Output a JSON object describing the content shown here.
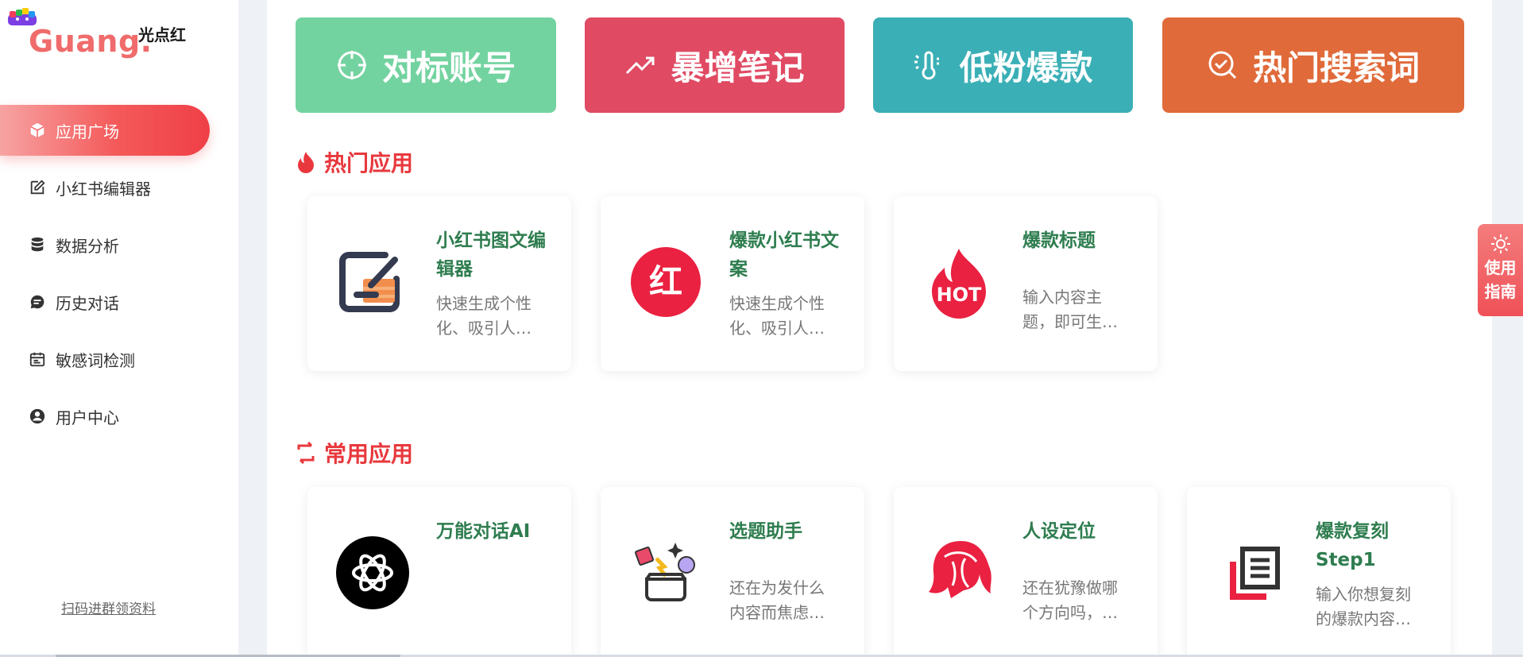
{
  "brand": {
    "logo": "Guang.",
    "subtitle": "光点红"
  },
  "sidebar": {
    "items": [
      {
        "label": "应用广场",
        "icon": "cube-icon",
        "active": true
      },
      {
        "label": "小红书编辑器",
        "icon": "edit-icon"
      },
      {
        "label": "数据分析",
        "icon": "database-icon"
      },
      {
        "label": "历史对话",
        "icon": "chat-icon"
      },
      {
        "label": "敏感词检测",
        "icon": "calendar-icon"
      },
      {
        "label": "用户中心",
        "icon": "user-icon"
      }
    ],
    "footer_link": "扫码进群领资料"
  },
  "quick_actions": [
    {
      "label": "对标账号",
      "icon": "crosshair-icon",
      "color": "#73d3a0"
    },
    {
      "label": "暴增笔记",
      "icon": "trending-up-icon",
      "color": "#e04a63"
    },
    {
      "label": "低粉爆款",
      "icon": "thermometer-icon",
      "color": "#3aafb6"
    },
    {
      "label": "热门搜索词",
      "icon": "search-check-icon",
      "color": "#e06a3a"
    }
  ],
  "hot_apps": {
    "title": "热门应用",
    "cards": [
      {
        "title": "小红书图文编辑器",
        "desc": "快速生成个性化、吸引人…",
        "icon": "editor-app-icon"
      },
      {
        "title": "爆款小红书文案",
        "desc": "快速生成个性化、吸引人…",
        "icon": "hong-logo-icon"
      },
      {
        "title": "爆款标题",
        "desc": "输入内容主题，即可生…",
        "icon": "hot-flame-icon"
      }
    ]
  },
  "common_apps": {
    "title": "常用应用",
    "cards": [
      {
        "title": "万能对话AI",
        "desc": "",
        "icon": "openai-icon"
      },
      {
        "title": "选题助手",
        "desc": "还在为发什么内容而焦虑…",
        "icon": "topic-helper-icon"
      },
      {
        "title": "人设定位",
        "desc": "还在犹豫做哪个方向吗，…",
        "icon": "persona-icon"
      },
      {
        "title": "爆款复刻Step1",
        "desc": "输入你想复刻的爆款内容…",
        "icon": "copy-document-icon"
      }
    ]
  },
  "guide": {
    "label_line1": "使用",
    "label_line2": "指南",
    "icon": "sun-icon"
  }
}
